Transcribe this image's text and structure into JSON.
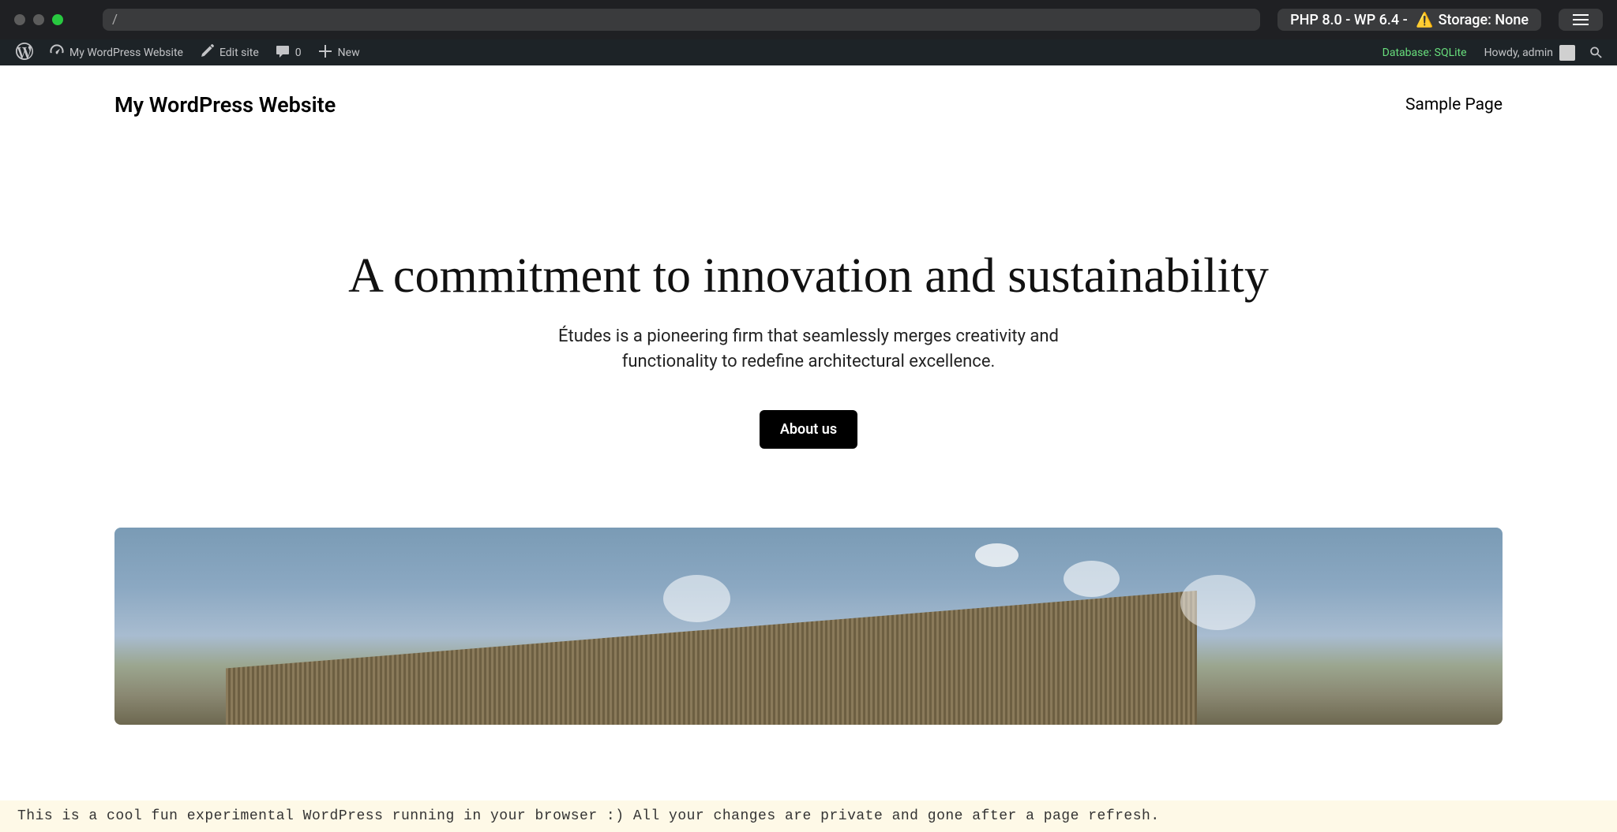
{
  "titlebar": {
    "url": "/",
    "env_php": "PHP 8.0",
    "env_wp": "WP 6.4",
    "env_storage": "Storage: None"
  },
  "adminbar": {
    "site_name": "My WordPress Website",
    "edit_site": "Edit site",
    "comments_count": "0",
    "new": "New",
    "database": "Database: SQLite",
    "howdy": "Howdy, admin"
  },
  "header": {
    "site_title": "My WordPress Website",
    "nav_link": "Sample Page"
  },
  "hero": {
    "title": "A commitment to innovation and sustainability",
    "subtitle": "Études is a pioneering firm that seamlessly merges creativity and functionality to redefine architectural excellence.",
    "button": "About us"
  },
  "footer": {
    "notice": "This is a cool fun experimental WordPress running in your browser :) All your changes are private and gone after a page refresh."
  }
}
